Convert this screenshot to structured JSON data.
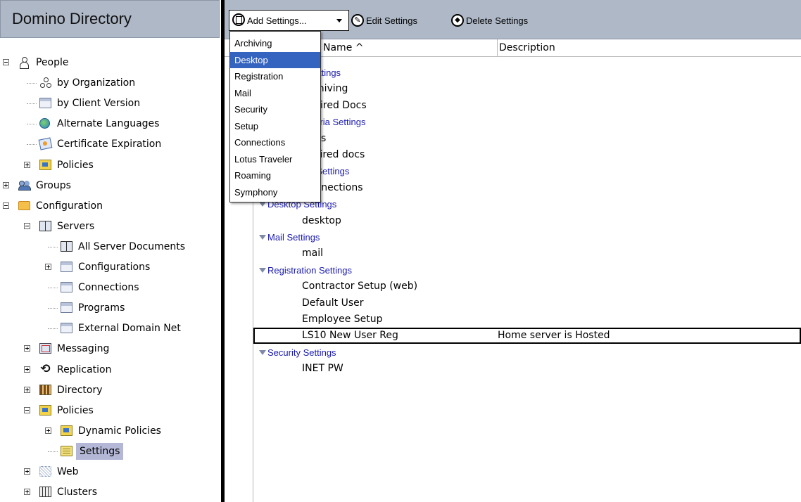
{
  "navigator": {
    "title": "Domino Directory",
    "tree": [
      {
        "label": "People",
        "icon": "person-icon",
        "expander": "minus"
      },
      {
        "label": "by Organization",
        "icon": "organization-icon"
      },
      {
        "label": "by Client Version",
        "icon": "view-icon"
      },
      {
        "label": "Alternate Languages",
        "icon": "globe-icon"
      },
      {
        "label": "Certificate Expiration",
        "icon": "certificate-icon"
      },
      {
        "label": "Policies",
        "icon": "policy-icon",
        "expander": "plus"
      },
      {
        "label": "Groups",
        "icon": "group-icon",
        "expander": "plus"
      },
      {
        "label": "Configuration",
        "icon": "folder-icon",
        "expander": "minus"
      },
      {
        "label": "Servers",
        "icon": "servers-icon",
        "expander": "minus"
      },
      {
        "label": "All Server Documents",
        "icon": "servers-icon"
      },
      {
        "label": "Configurations",
        "icon": "view-icon",
        "expander": "plus"
      },
      {
        "label": "Connections",
        "icon": "view-icon"
      },
      {
        "label": "Programs",
        "icon": "view-icon"
      },
      {
        "label": "External Domain Net",
        "icon": "view-icon"
      },
      {
        "label": "Messaging",
        "icon": "messaging-icon",
        "expander": "plus"
      },
      {
        "label": "Replication",
        "icon": "replication-icon",
        "expander": "plus"
      },
      {
        "label": "Directory",
        "icon": "directory-icon",
        "expander": "plus"
      },
      {
        "label": "Policies",
        "icon": "policy-icon",
        "expander": "minus"
      },
      {
        "label": "Dynamic Policies",
        "icon": "policy-icon",
        "expander": "plus"
      },
      {
        "label": "Settings",
        "icon": "settings-icon",
        "selected": true
      },
      {
        "label": "Web",
        "icon": "web-icon",
        "expander": "plus"
      },
      {
        "label": "Clusters",
        "icon": "clusters-icon",
        "expander": "plus"
      }
    ]
  },
  "toolbar": {
    "add_label": "Add Settings...",
    "edit_label": "Edit Settings",
    "delete_label": "Delete Settings"
  },
  "add_menu": {
    "items": [
      "Archiving",
      "Desktop",
      "Registration",
      "Mail",
      "Security",
      "Setup",
      "Connections",
      "Lotus Traveler",
      "Roaming",
      "Symphony"
    ],
    "highlighted": "Desktop"
  },
  "view": {
    "columns": {
      "name": "Name ^",
      "description": "Description"
    },
    "rows": [
      {
        "type": "category",
        "text": "Archiving Settings"
      },
      {
        "type": "doc",
        "name": "Archiving",
        "desc": ""
      },
      {
        "type": "doc",
        "name": "Expired Docs",
        "desc": ""
      },
      {
        "type": "category",
        "text": "Archive Criteria Settings"
      },
      {
        "type": "doc",
        "name": "Docs",
        "desc": ""
      },
      {
        "type": "doc",
        "name": "expired docs",
        "desc": ""
      },
      {
        "type": "category",
        "text": "Connection Settings"
      },
      {
        "type": "doc",
        "name": "Connections",
        "desc": ""
      },
      {
        "type": "category",
        "text": "Desktop Settings"
      },
      {
        "type": "doc",
        "name": "desktop",
        "desc": ""
      },
      {
        "type": "category",
        "text": "Mail Settings"
      },
      {
        "type": "doc",
        "name": "mail",
        "desc": ""
      },
      {
        "type": "category",
        "text": "Registration Settings"
      },
      {
        "type": "doc",
        "name": "Contractor Setup (web)",
        "desc": ""
      },
      {
        "type": "doc",
        "name": "Default User",
        "desc": ""
      },
      {
        "type": "doc",
        "name": "Employee Setup",
        "desc": ""
      },
      {
        "type": "doc",
        "name": "LS10 New User Reg",
        "desc": "Home server is Hosted",
        "selected": true
      },
      {
        "type": "category",
        "text": "Security Settings"
      },
      {
        "type": "doc",
        "name": "INET PW",
        "desc": ""
      }
    ]
  },
  "colors": {
    "header_bg": "#aeb8c7",
    "category_text": "#1a1ab0",
    "menu_highlight": "#3563c0",
    "tree_selection": "#b4b8d6"
  }
}
